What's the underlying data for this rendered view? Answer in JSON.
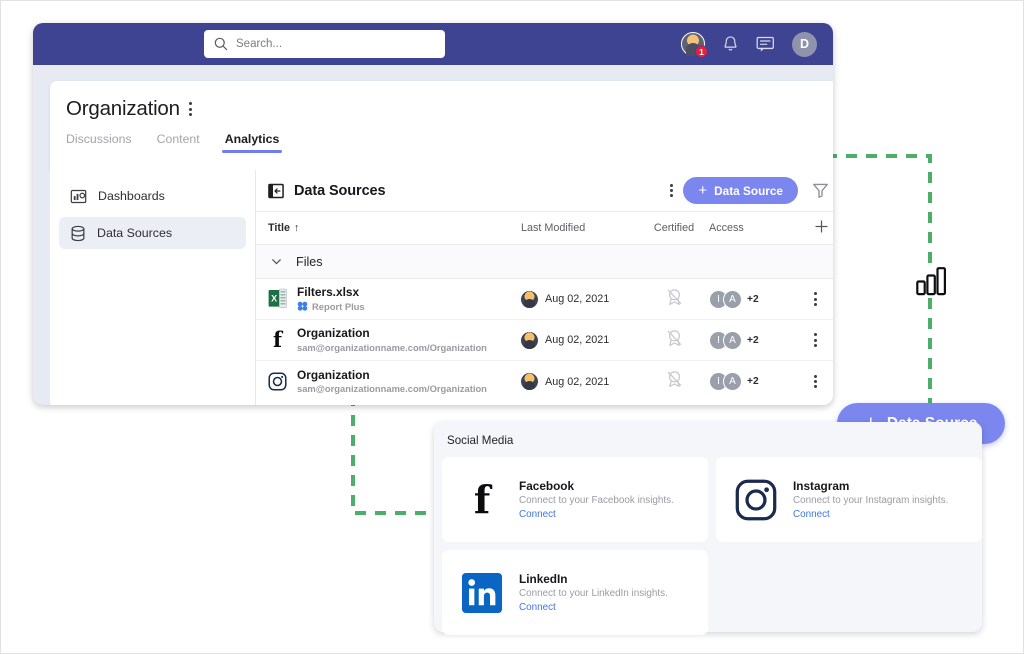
{
  "colors": {
    "topbar": "#3f4492",
    "accent": "#7b86ef",
    "tab_underline": "#6f7df0",
    "link": "#3f76e8",
    "dashed_guide": "#4caf67",
    "excel_green": "#1d7044",
    "linkedin_blue": "#0a66c2"
  },
  "topbar": {
    "search": {
      "placeholder": "Search...",
      "value": "",
      "icon": "search-icon"
    },
    "notification_avatar": {
      "icon": "user-avatar-icon",
      "badge_count": "1"
    },
    "bell_icon": "bell-icon",
    "chat_icon": "chat-icon",
    "user_avatar_initial": "D"
  },
  "page": {
    "title": "Organization",
    "menu_icon": "kebab-menu-icon",
    "tabs": [
      {
        "label": "Discussions",
        "active": false
      },
      {
        "label": "Content",
        "active": false
      },
      {
        "label": "Analytics",
        "active": true
      }
    ]
  },
  "sidebar": {
    "items": [
      {
        "label": "Dashboards",
        "icon": "dashboard-chart-icon",
        "active": false
      },
      {
        "label": "Data Sources",
        "icon": "database-icon",
        "active": true
      }
    ]
  },
  "data_sources_panel": {
    "collapse_icon": "collapse-panel-icon",
    "title": "Data Sources",
    "menu_icon": "kebab-menu-icon",
    "add_button": {
      "label": "Data Source",
      "plus": "+"
    },
    "filter_icon": "filter-icon",
    "columns": {
      "title": "Title",
      "sort_indicator": "↑",
      "last_modified": "Last Modified",
      "certified": "Certified",
      "access": "Access",
      "add_column_icon": "plus-icon"
    },
    "group": {
      "label": "Files",
      "chevron_icon": "chevron-down-icon"
    },
    "rows": [
      {
        "icon": "excel-file-icon",
        "name": "Filters.xlsx",
        "subtitle": "Report Plus",
        "subtitle_icon": "report-plus-icon",
        "last_modified": "Aug 02, 2021",
        "modifier_avatar": "user-avatar-icon",
        "certified_icon": "not-certified-icon",
        "access": {
          "avatars": [
            "I",
            "A"
          ],
          "overflow": "+2"
        },
        "row_menu_icon": "kebab-menu-icon"
      },
      {
        "icon": "facebook-icon",
        "name": "Organization",
        "subtitle": "sam@organizationname.com/Organization",
        "subtitle_icon": "",
        "last_modified": "Aug 02, 2021",
        "modifier_avatar": "user-avatar-icon",
        "certified_icon": "not-certified-icon",
        "access": {
          "avatars": [
            "I",
            "A"
          ],
          "overflow": "+2"
        },
        "row_menu_icon": "kebab-menu-icon"
      },
      {
        "icon": "instagram-icon",
        "name": "Organization",
        "subtitle": "sam@organizationname.com/Organization",
        "subtitle_icon": "",
        "last_modified": "Aug 02, 2021",
        "modifier_avatar": "user-avatar-icon",
        "certified_icon": "not-certified-icon",
        "access": {
          "avatars": [
            "I",
            "A"
          ],
          "overflow": "+2"
        },
        "row_menu_icon": "kebab-menu-icon"
      }
    ]
  },
  "floating_button": {
    "label": "Data Source",
    "plus": "+"
  },
  "callout": {
    "chart_icon": "bar-chart-icon"
  },
  "social_panel": {
    "title": "Social Media",
    "cards": [
      {
        "icon": "facebook-icon",
        "title": "Facebook",
        "description": "Connect to your Facebook insights.",
        "link": "Connect"
      },
      {
        "icon": "instagram-icon",
        "title": "Instagram",
        "description": "Connect to your Instagram insights.",
        "link": "Connect"
      },
      {
        "icon": "linkedin-icon",
        "title": "LinkedIn",
        "description": "Connect to your LinkedIn insights.",
        "link": "Connect"
      }
    ]
  }
}
